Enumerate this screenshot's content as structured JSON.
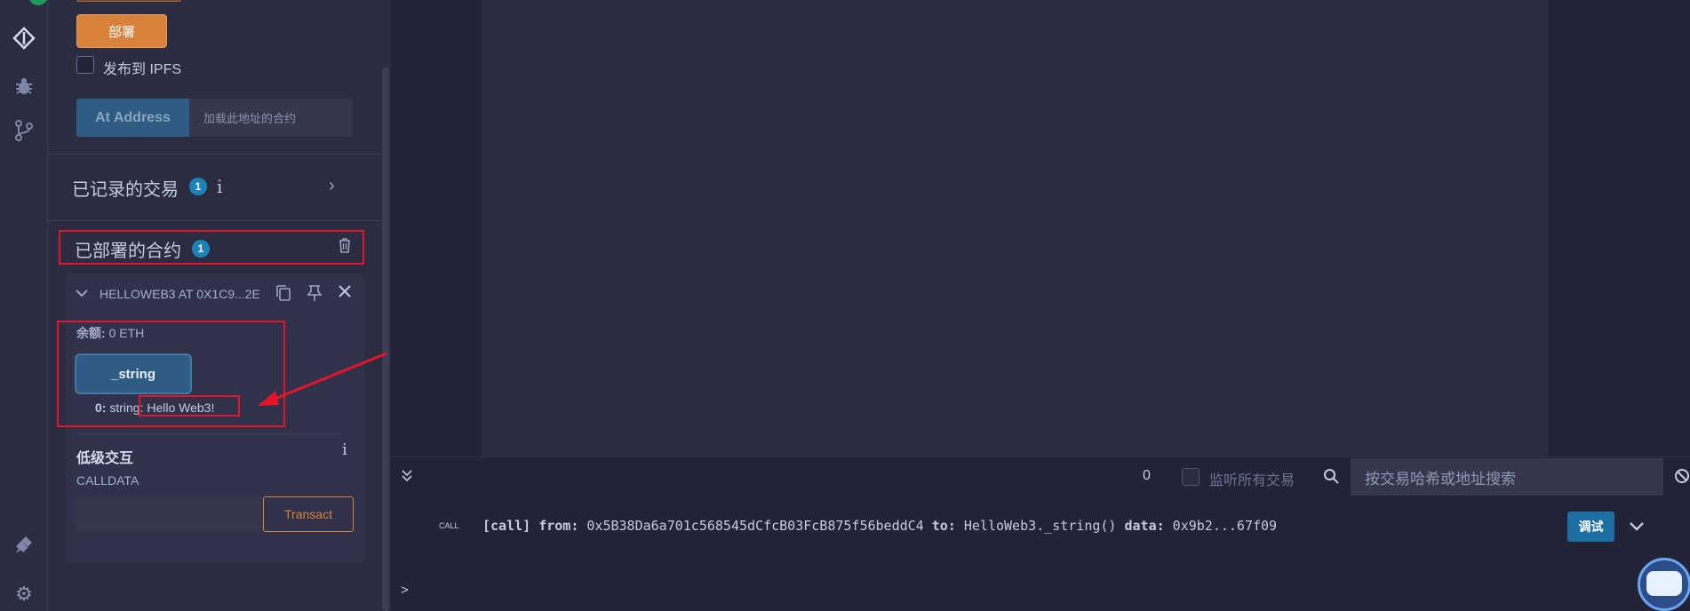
{
  "sidebar": {
    "deploy_label": "部署",
    "publish_ipfs_label": "发布到 IPFS",
    "at_address_label": "At Address",
    "at_address_placeholder": "加载此地址的合约",
    "recorded_tx_title": "已记录的交易",
    "recorded_tx_count": "1",
    "deployed_title": "已部署的合约",
    "deployed_count": "1",
    "contract": {
      "name": "HELLOWEB3 AT 0X1C9...2E",
      "balance_label": "余额:",
      "balance_value": "0 ETH",
      "function_label": "_string",
      "result_index": "0:",
      "result_type": "string:",
      "result_value": "Hello Web3!"
    },
    "low_level_title": "低级交互",
    "calldata_label": "CALLDATA",
    "transact_label": "Transact"
  },
  "terminal": {
    "pending_count": "0",
    "listen_all_label": "监听所有交易",
    "search_placeholder": "按交易哈希或地址搜索",
    "call_tag": "CALL",
    "tx": {
      "kind": "[call]",
      "from_label": "from:",
      "from": "0x5B38Da6a701c568545dCfcB03FcB875f56beddC4",
      "to_label": "to:",
      "to": "HelloWeb3._string()",
      "data_label": "data:",
      "data": "0x9b2...67f09"
    },
    "debug_label": "调试",
    "prompt": ">"
  },
  "icons": [
    "check-badge-icon",
    "solidity-deploy-icon",
    "debugger-bug-icon",
    "git-branch-icon",
    "plugin-icon",
    "settings-gear-icon"
  ],
  "colors": {
    "deploy_orange": "#d9823b",
    "at_address_blue": "#2f5c82",
    "badge_blue": "#1c82b8",
    "annotation_red": "#e3142b"
  }
}
